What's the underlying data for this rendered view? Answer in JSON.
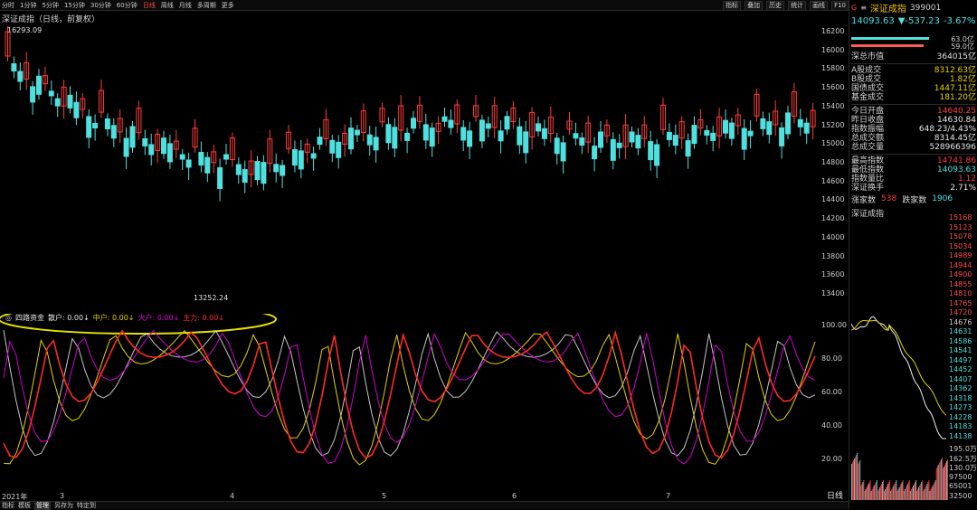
{
  "top_bar": {
    "items": [
      "分时",
      "1分钟",
      "5分钟",
      "15分钟",
      "30分钟",
      "60分钟",
      "日线",
      "周线",
      "月线",
      "多周期",
      "更多"
    ],
    "active_index": 6,
    "right_buttons": [
      "指标",
      "叠加",
      "历史",
      "统计",
      "画线",
      "F10"
    ]
  },
  "main_chart": {
    "title": "深证成指（日线，前复权）",
    "high_label": "16293.09",
    "low_label": "13252.24",
    "y_ticks": [
      "16200",
      "16000",
      "15800",
      "15600",
      "15400",
      "15200",
      "15000",
      "14800",
      "14600",
      "14400",
      "14200",
      "14000",
      "13800",
      "13600",
      "13400"
    ],
    "x_ticks": [
      {
        "label": "2021年"
      },
      {
        "label": "3"
      },
      {
        "label": "4"
      },
      {
        "label": "5"
      },
      {
        "label": "6"
      },
      {
        "label": "7"
      }
    ]
  },
  "sub_chart": {
    "legend": {
      "title": "四路资金",
      "retail": "散户: 0.00↓",
      "mid": "中户: 0.00↓",
      "large": "大户: 0.00↓",
      "main": "主力: 0.00↓"
    },
    "y_ticks": [
      "100.00",
      "80.00",
      "60.00",
      "40.00",
      "20.00"
    ]
  },
  "bottom_tabs": {
    "items": [
      "指标",
      "模板",
      "管理",
      "另存为",
      "特定到"
    ],
    "active_index": 2,
    "right_label": "日线"
  },
  "sidebar": {
    "index_name": "深证成指",
    "code": "399001",
    "price": "14093.63",
    "change": "▼-537.23",
    "pct": "-3.67%",
    "bar1_value": "63.0亿",
    "bar2_value": "59.0亿",
    "rows": [
      {
        "k": "深总市值",
        "v": "364015亿"
      },
      {
        "k": "A股成交",
        "v": "8312.63亿"
      },
      {
        "k": "B股成交",
        "v": "1.82亿"
      },
      {
        "k": "国债成交",
        "v": "1447.11亿"
      },
      {
        "k": "基金成交",
        "v": "181.20亿"
      },
      {
        "k": "今日开盘",
        "v": "14640.25"
      },
      {
        "k": "昨日收盘",
        "v": "14630.84"
      },
      {
        "k": "指数振幅",
        "v": "648.23/4.43%"
      },
      {
        "k": "总成交额",
        "v": "8314.45亿"
      },
      {
        "k": "总成交量",
        "v": "528966396"
      },
      {
        "k": "最高指数",
        "v": "14741.86"
      },
      {
        "k": "最低指数",
        "v": "14093.63"
      },
      {
        "k": "指数量比",
        "v": "1.12"
      },
      {
        "k": "深证换手",
        "v": "2.71%"
      }
    ],
    "up_label": "涨家数",
    "up_value": "538",
    "down_label": "跌家数",
    "down_value": "1906",
    "mini_title": "深证成指",
    "mini_ticks": [
      "15168",
      "15123",
      "15078",
      "15034",
      "14989",
      "14944",
      "14900",
      "14855",
      "14810",
      "14765",
      "14720",
      "14676",
      "14631",
      "14586",
      "14541",
      "14497",
      "14452",
      "14407",
      "14362",
      "14318",
      "14273",
      "14228",
      "14183",
      "14138"
    ],
    "mini_vol_ticks": [
      "195.0万",
      "162.5万",
      "130.0万",
      "97500",
      "65001",
      "32500"
    ]
  },
  "colors": {
    "up": "#ff3b3b",
    "down": "#4fe0e0",
    "white_line": "#e8e8e8",
    "yellow_line": "#e6d200",
    "magenta_line": "#d000d0",
    "red_line": "#ff2a2a"
  }
}
